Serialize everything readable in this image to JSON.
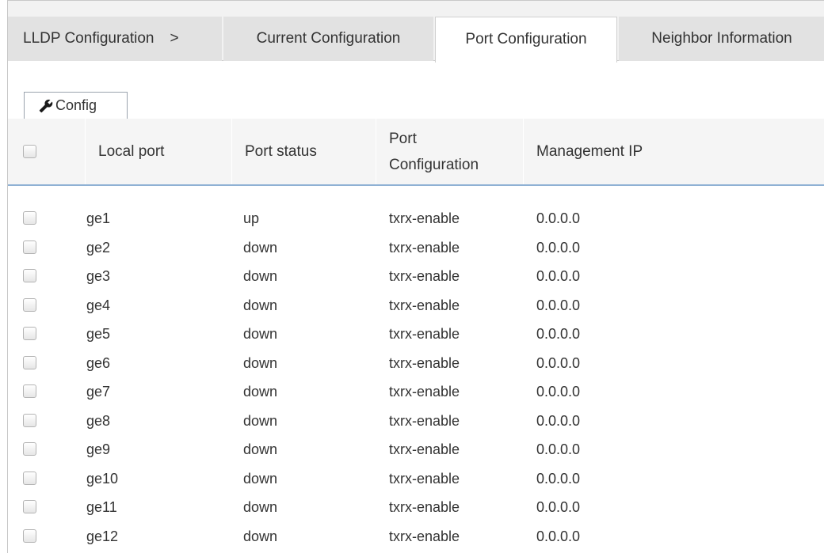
{
  "breadcrumb": {
    "label": "LLDP Configuration",
    "separator": ">"
  },
  "tabs": [
    {
      "label": "Current Configuration",
      "active": false
    },
    {
      "label": "Port Configuration",
      "active": true
    },
    {
      "label": "Neighbor Information",
      "active": false
    }
  ],
  "toolbar": {
    "config_label": "Config",
    "config_icon": "wrench-icon"
  },
  "table": {
    "columns": [
      "Local port",
      "Port status",
      "Port Configuration",
      "Management IP"
    ],
    "column_lines": [
      [
        "Local port"
      ],
      [
        "Port status"
      ],
      [
        "Port",
        "Configuration"
      ],
      [
        "Management IP"
      ]
    ],
    "rows": [
      {
        "local_port": "ge1",
        "port_status": "up",
        "port_configuration": "txrx-enable",
        "management_ip": "0.0.0.0"
      },
      {
        "local_port": "ge2",
        "port_status": "down",
        "port_configuration": "txrx-enable",
        "management_ip": "0.0.0.0"
      },
      {
        "local_port": "ge3",
        "port_status": "down",
        "port_configuration": "txrx-enable",
        "management_ip": "0.0.0.0"
      },
      {
        "local_port": "ge4",
        "port_status": "down",
        "port_configuration": "txrx-enable",
        "management_ip": "0.0.0.0"
      },
      {
        "local_port": "ge5",
        "port_status": "down",
        "port_configuration": "txrx-enable",
        "management_ip": "0.0.0.0"
      },
      {
        "local_port": "ge6",
        "port_status": "down",
        "port_configuration": "txrx-enable",
        "management_ip": "0.0.0.0"
      },
      {
        "local_port": "ge7",
        "port_status": "down",
        "port_configuration": "txrx-enable",
        "management_ip": "0.0.0.0"
      },
      {
        "local_port": "ge8",
        "port_status": "down",
        "port_configuration": "txrx-enable",
        "management_ip": "0.0.0.0"
      },
      {
        "local_port": "ge9",
        "port_status": "down",
        "port_configuration": "txrx-enable",
        "management_ip": "0.0.0.0"
      },
      {
        "local_port": "ge10",
        "port_status": "down",
        "port_configuration": "txrx-enable",
        "management_ip": "0.0.0.0"
      },
      {
        "local_port": "ge11",
        "port_status": "down",
        "port_configuration": "txrx-enable",
        "management_ip": "0.0.0.0"
      },
      {
        "local_port": "ge12",
        "port_status": "down",
        "port_configuration": "txrx-enable",
        "management_ip": "0.0.0.0"
      }
    ]
  },
  "colors": {
    "header_underline": "#8fb1d4",
    "tab_inactive": "#e2e2e2",
    "tab_active": "#ffffff"
  }
}
